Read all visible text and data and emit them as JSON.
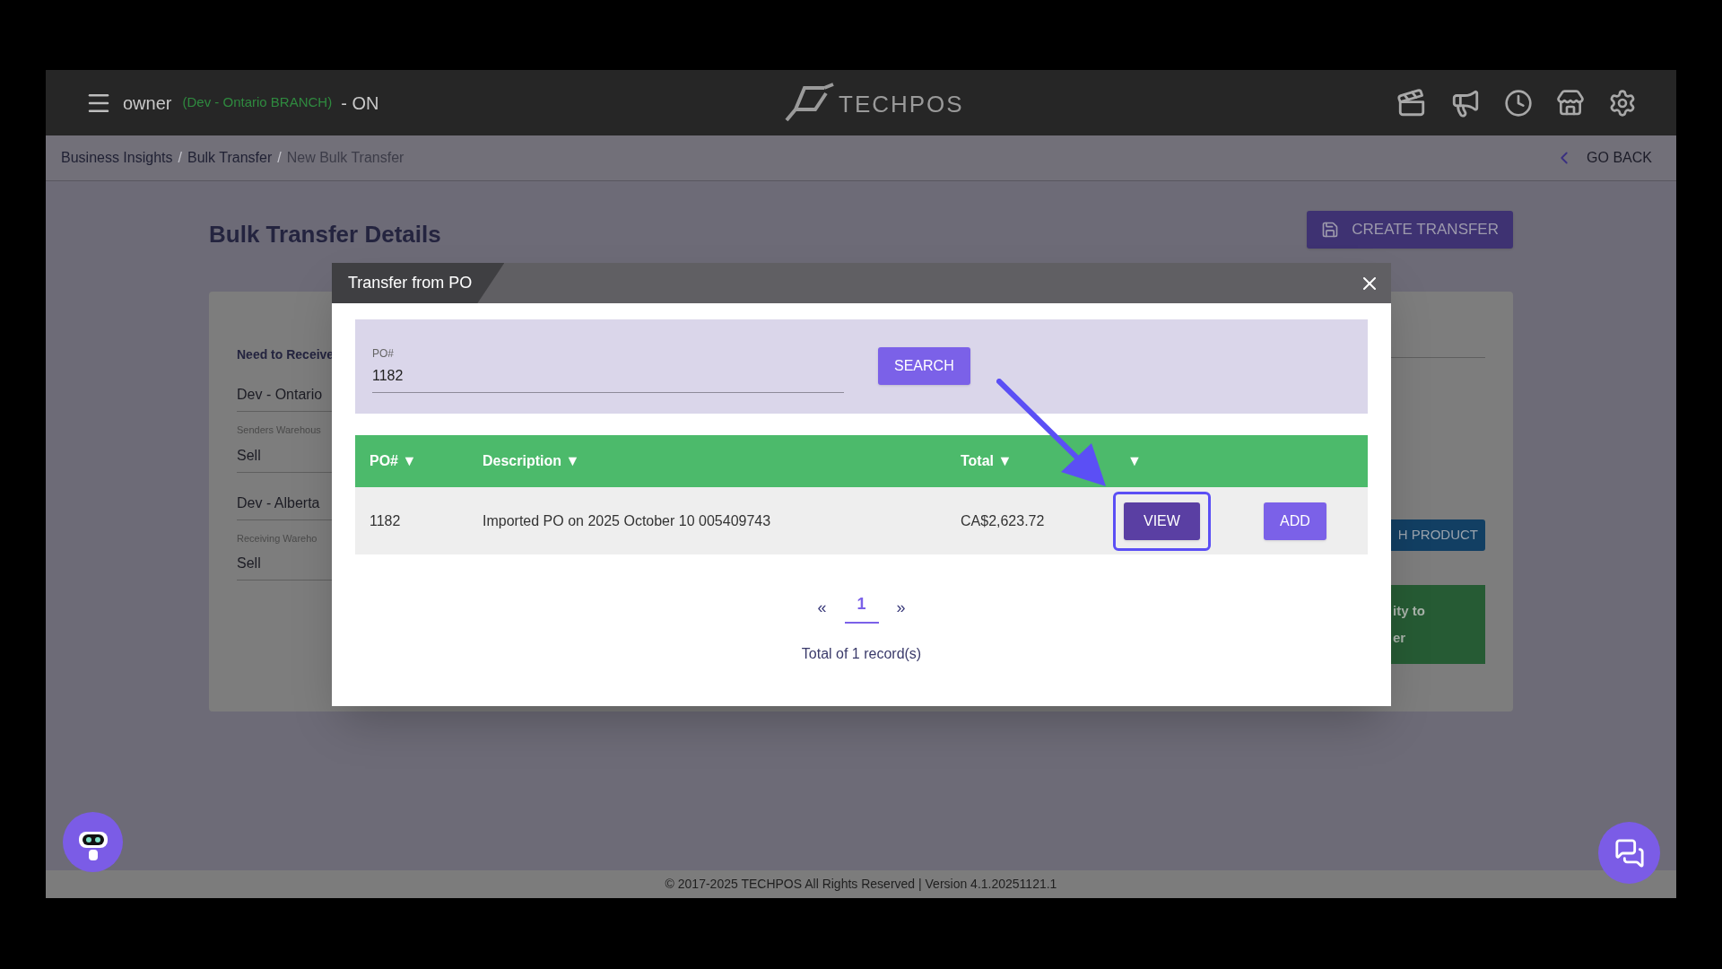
{
  "header": {
    "user": "owner",
    "branch": "(Dev - Ontario BRANCH)",
    "region": "- ON",
    "logo": "TECHPOS"
  },
  "breadcrumb": [
    {
      "label": "Business Insights",
      "separator": "/"
    },
    {
      "label": "Bulk Transfer",
      "separator": "/"
    },
    {
      "label": "New Bulk Transfer"
    }
  ],
  "go_back": "GO BACK",
  "page": {
    "title": "Bulk Transfer Details",
    "create_button": "CREATE TRANSFER",
    "fields": [
      {
        "kind": "heading",
        "text": "Need to Receive"
      },
      {
        "kind": "value",
        "text": "Dev - Ontario"
      },
      {
        "kind": "labeled",
        "label": "Senders Warehous",
        "value": "Sell"
      },
      {
        "kind": "value",
        "text": "Dev - Alberta"
      },
      {
        "kind": "labeled",
        "label": "Receiving Wareho",
        "value": "Sell"
      }
    ],
    "side_button": "H PRODUCT",
    "side_note": [
      "ity to",
      "er"
    ]
  },
  "modal": {
    "title": "Transfer from PO",
    "search": {
      "label": "PO#",
      "value": "1182"
    },
    "search_button": "SEARCH",
    "columns": [
      "PO# ▼",
      "Description ▼",
      "Total ▼",
      "▼"
    ],
    "rows": [
      {
        "cells": [
          "1182",
          "Imported PO on 2025 October 10 005409743",
          "CA$2,623.72"
        ],
        "actions": [
          {
            "label": "VIEW",
            "highlighted": true
          },
          {
            "label": "ADD",
            "highlighted": false
          }
        ]
      }
    ],
    "pagination": {
      "prev": "«",
      "pages": [
        {
          "label": "1",
          "selected": true
        }
      ],
      "next": "»"
    },
    "total": "Total of 1 record(s)"
  },
  "footer": "© 2017-2025 TECHPOS All Rights Reserved | Version 4.1.20251121.1"
}
